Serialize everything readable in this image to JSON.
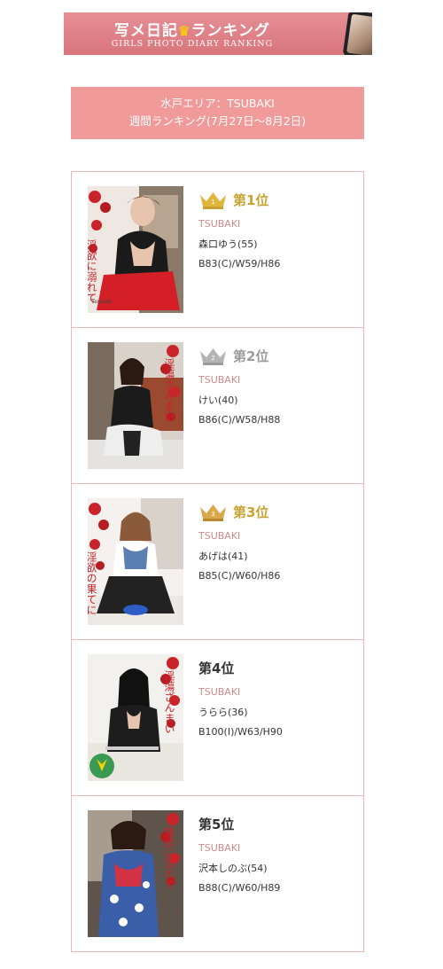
{
  "banner": {
    "title_a": "写メ日記",
    "title_b": "ランキング",
    "subtitle": "GIRLS PHOTO DIARY RANKING"
  },
  "area": {
    "line1": "水戸エリア：TSUBAKI",
    "line2": "週間ランキング(7月27日～8月2日)"
  },
  "ranking": [
    {
      "rank": "第1位",
      "shop": "TSUBAKI",
      "name": "森口ゆう(55)",
      "size": "B83(C)/W59/H86",
      "crown": "gold",
      "caption": "淫欲に溺れて"
    },
    {
      "rank": "第2位",
      "shop": "TSUBAKI",
      "name": "けい(40)",
      "size": "B86(C)/W58/H88",
      "crown": "silver",
      "caption": "淫蕩ざんまい"
    },
    {
      "rank": "第3位",
      "shop": "TSUBAKI",
      "name": "あげは(41)",
      "size": "B85(C)/W60/H86",
      "crown": "bronze",
      "caption": "淫欲の果てに"
    },
    {
      "rank": "第4位",
      "shop": "TSUBAKI",
      "name": "うらら(36)",
      "size": "B100(I)/W63/H90",
      "crown": "none",
      "caption": "淫蕩ざんまい"
    },
    {
      "rank": "第5位",
      "shop": "TSUBAKI",
      "name": "沢本しのぶ(54)",
      "size": "B88(C)/W60/H89",
      "crown": "none",
      "caption": "情欲に溺れて"
    }
  ],
  "colors": {
    "accent_pink": "#f09a9a",
    "border_pink": "#f1b7b7",
    "shop_text": "#d08a8a",
    "gold": "#c9a233",
    "silver": "#9b9b9b"
  }
}
